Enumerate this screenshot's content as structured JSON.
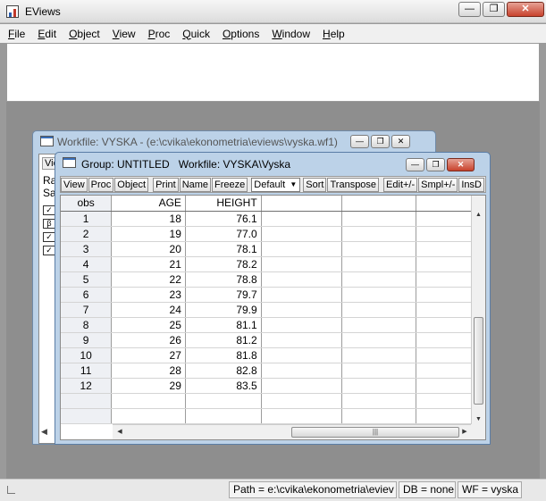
{
  "app": {
    "title": "EViews",
    "window_controls": [
      "—",
      "❐",
      "✕"
    ]
  },
  "menu": [
    {
      "label": "File",
      "key": "F",
      "rest": "ile"
    },
    {
      "label": "Edit",
      "key": "E",
      "rest": "dit"
    },
    {
      "label": "Object",
      "key": "O",
      "rest": "bject"
    },
    {
      "label": "View",
      "key": "V",
      "rest": "iew"
    },
    {
      "label": "Proc",
      "key": "P",
      "rest": "roc"
    },
    {
      "label": "Quick",
      "key": "Q",
      "rest": "uick"
    },
    {
      "label": "Options",
      "key": "O",
      "rest": "ptions"
    },
    {
      "label": "Window",
      "key": "W",
      "rest": "indow"
    },
    {
      "label": "Help",
      "key": "H",
      "rest": "elp"
    }
  ],
  "workfile_window": {
    "title": "Workfile: VYSKA - (e:\\cvika\\ekonometria\\eviews\\vyska.wf1)",
    "partial_text": [
      "Ra",
      "Sa"
    ],
    "tab_label": "Vie",
    "object_icons": [
      "✓",
      "β",
      "✓",
      "✓"
    ]
  },
  "group_window": {
    "title_left": "Group: UNTITLED",
    "title_right": "Workfile: VYSKA\\Vyska",
    "toolbar": {
      "view": "View",
      "proc": "Proc",
      "object": "Object",
      "print": "Print",
      "name": "Name",
      "freeze": "Freeze",
      "select_value": "Default",
      "sort": "Sort",
      "transpose": "Transpose",
      "edit": "Edit+/-",
      "smpl": "Smpl+/-",
      "ins": "InsD"
    },
    "columns": [
      "obs",
      "AGE",
      "HEIGHT"
    ],
    "rows": [
      {
        "obs": "1",
        "age": "18",
        "height": "76.1"
      },
      {
        "obs": "2",
        "age": "19",
        "height": "77.0"
      },
      {
        "obs": "3",
        "age": "20",
        "height": "78.1"
      },
      {
        "obs": "4",
        "age": "21",
        "height": "78.2"
      },
      {
        "obs": "5",
        "age": "22",
        "height": "78.8"
      },
      {
        "obs": "6",
        "age": "23",
        "height": "79.7"
      },
      {
        "obs": "7",
        "age": "24",
        "height": "79.9"
      },
      {
        "obs": "8",
        "age": "25",
        "height": "81.1"
      },
      {
        "obs": "9",
        "age": "26",
        "height": "81.2"
      },
      {
        "obs": "10",
        "age": "27",
        "height": "81.8"
      },
      {
        "obs": "11",
        "age": "28",
        "height": "82.8"
      },
      {
        "obs": "12",
        "age": "29",
        "height": "83.5"
      }
    ],
    "empty_rows": 2
  },
  "status": {
    "path": "Path = e:\\cvika\\ekonometria\\eviev",
    "db": "DB = none",
    "wf": "WF = vyska"
  },
  "colors": {
    "window_frame": "#bcd2e8",
    "close_button": "#c8422c"
  }
}
